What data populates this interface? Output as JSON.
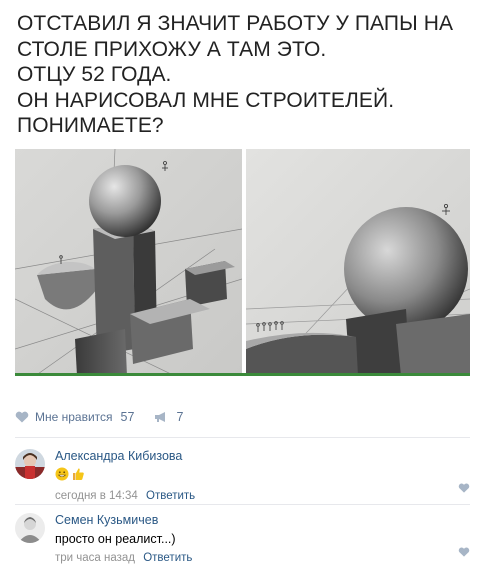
{
  "post": {
    "lines": [
      "ОТСТАВИЛ Я ЗНАЧИТ РАБОТУ У ПАПЫ НА",
      "СТОЛЕ ПРИХОЖУ А ТАМ ЭТО.",
      "ОТЦУ 52 ГОДА.",
      "ОН НАРИСОВАЛ МНЕ СТРОИТЕЛЕЙ.",
      "ПОНИМАЕТЕ?"
    ]
  },
  "actions": {
    "like_label": "Мне нравится",
    "like_count": "57",
    "share_count": "7"
  },
  "comments": [
    {
      "author": "Александра Кибизова",
      "time": "сегодня в 14:34",
      "reply": "Ответить",
      "emoji": [
        "grin-emoji",
        "thumbs-up-emoji"
      ]
    },
    {
      "author": "Семен Кузьмичев",
      "text": "просто он реалист...)",
      "time": "три часа назад",
      "reply": "Ответить"
    }
  ],
  "colors": {
    "link": "#2a5885",
    "muted": "#939393",
    "action": "#5b7393",
    "heart": "#a7b5c6"
  }
}
